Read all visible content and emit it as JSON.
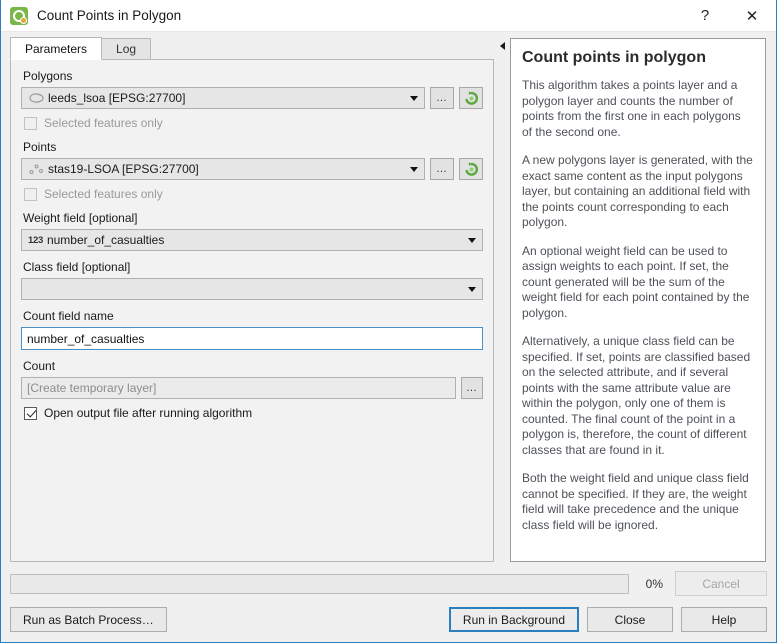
{
  "window": {
    "title": "Count Points in Polygon",
    "app_icon": "qgis-logo-icon",
    "help_btn": "?",
    "close_btn": "✕"
  },
  "tabs": [
    {
      "label": "Parameters",
      "active": true
    },
    {
      "label": "Log",
      "active": false
    }
  ],
  "parameters": {
    "polygons": {
      "label": "Polygons",
      "value": "leeds_lsoa [EPSG:27700]",
      "icon": "polygon-layer-icon",
      "browse_label": "…",
      "iterate_icon": "iterate-over-features-icon"
    },
    "polygons_selected_only": {
      "label": "Selected features only",
      "checked": false,
      "enabled": false
    },
    "points": {
      "label": "Points",
      "value": "stas19-LSOA [EPSG:27700]",
      "icon": "point-layer-icon",
      "browse_label": "…",
      "iterate_icon": "iterate-over-features-icon"
    },
    "points_selected_only": {
      "label": "Selected features only",
      "checked": false,
      "enabled": false
    },
    "weight_field": {
      "label": "Weight field [optional]",
      "value": "number_of_casualties",
      "type_icon": "123"
    },
    "class_field": {
      "label": "Class field [optional]",
      "value": ""
    },
    "count_field_name": {
      "label": "Count field name",
      "value": "number_of_casualties",
      "focused": true
    },
    "count_output": {
      "label": "Count",
      "placeholder": "[Create temporary layer]",
      "value": "",
      "browse_label": "…"
    },
    "open_output": {
      "label": "Open output file after running algorithm",
      "checked": true
    }
  },
  "splitter": {
    "collapse_icon": "collapse-left-arrow-icon"
  },
  "help": {
    "title": "Count points in polygon",
    "paragraphs": [
      "This algorithm takes a points layer and a polygon layer and counts the number of points from the first one in each polygons of the second one.",
      "A new polygons layer is generated, with the exact same content as the input polygons layer, but containing an additional field with the points count corresponding to each polygon.",
      "An optional weight field can be used to assign weights to each point. If set, the count generated will be the sum of the weight field for each point contained by the polygon.",
      "Alternatively, a unique class field can be specified. If set, points are classified based on the selected attribute, and if several points with the same attribute value are within the polygon, only one of them is counted. The final count of the point in a polygon is, therefore, the count of different classes that are found in it.",
      "Both the weight field and unique class field cannot be specified. If they are, the weight field will take precedence and the unique class field will be ignored."
    ]
  },
  "footer": {
    "progress_percent": "0%",
    "progress_value": 0,
    "cancel_label": "Cancel",
    "batch_label": "Run as Batch Process…",
    "run_label": "Run in Background",
    "close_label": "Close",
    "help_label": "Help"
  },
  "colors": {
    "accent": "#2a7fc0",
    "dialog_bg": "#f0f0f0",
    "panel_bg": "#f2f2f2",
    "qgis_green": "#7ab648",
    "qgis_orange": "#e8a33d"
  }
}
